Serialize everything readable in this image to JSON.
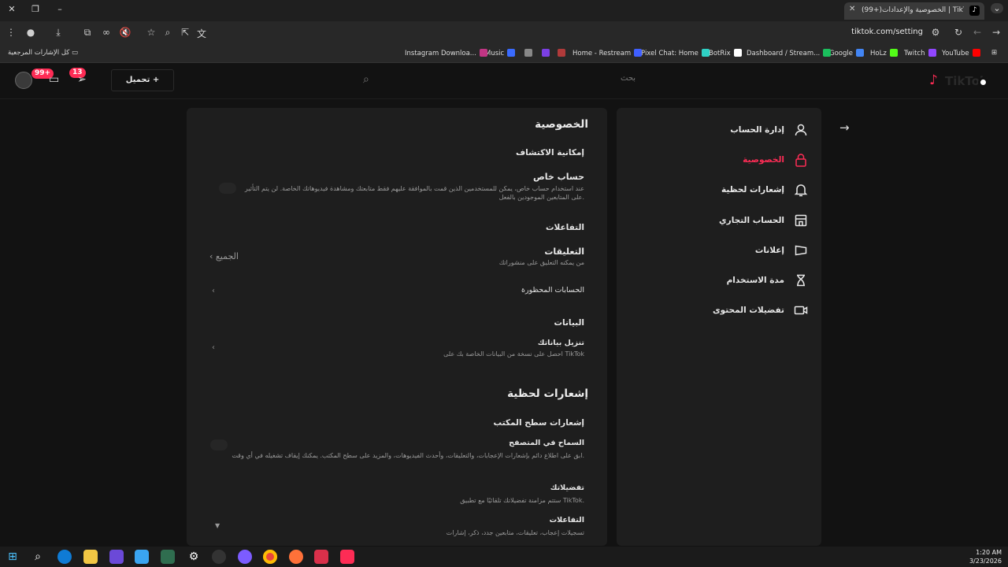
{
  "browser": {
    "tab_title": "(99+)الخصوصية والإعدادات | TikTok",
    "tab_icon": "tiktok-icon",
    "url": "tiktok.com/setting",
    "bookmarks_all_label": "كل الإشارات المرجعية",
    "bookmarks": [
      {
        "label": "YouTube",
        "color": "#ff0000"
      },
      {
        "label": "Twitch",
        "color": "#9146ff"
      },
      {
        "label": "HoLz",
        "color": "#53fc18"
      },
      {
        "label": "Google",
        "color": "#4285f4"
      },
      {
        "label": "Dashboard / Stream...",
        "color": "#1bbf5d"
      },
      {
        "label": "BotRix",
        "color": "#ffffff"
      },
      {
        "label": "Pixel Chat: Home",
        "color": "#2fd1c5"
      },
      {
        "label": "Home - Restream",
        "color": "#3f5fff"
      },
      {
        "label": "Music",
        "color": "#3a6bff"
      },
      {
        "label": "Instagram Downloa...",
        "color": "#c13584"
      }
    ]
  },
  "header": {
    "upload_label": "تحميل",
    "search_placeholder": "بحث",
    "inbox_badge": "99+",
    "notifications_badge": "13",
    "logo_text": "TikTok"
  },
  "nav": {
    "items": [
      {
        "label": "إدارة الحساب",
        "icon": "person-icon",
        "active": false
      },
      {
        "label": "الخصوصية",
        "icon": "lock-icon",
        "active": true
      },
      {
        "label": "إشعارات لحظية",
        "icon": "bell-icon",
        "active": false
      },
      {
        "label": "الحساب التجاري",
        "icon": "store-icon",
        "active": false
      },
      {
        "label": "إعلانات",
        "icon": "megaphone-icon",
        "active": false
      },
      {
        "label": "مدة الاستخدام",
        "icon": "hourglass-icon",
        "active": false
      },
      {
        "label": "تفضيلات المحتوى",
        "icon": "video-icon",
        "active": false
      }
    ],
    "back_icon": "arrow-right-icon"
  },
  "privacy": {
    "title": "الخصوصية",
    "discoverability": "إمكانية الاكتشاف",
    "private_account_title": "حساب خاص",
    "private_account_desc": "عند استخدام حساب خاص، يمكن للمستخدمين الذين قمت بالموافقة عليهم فقط متابعتك ومشاهدة فيديوهاتك الخاصة. لن يتم التأثير على المتابعين الموجودين بالفعل.",
    "interactions": "التفاعلات",
    "comments_title": "التعليقات",
    "comments_desc": "من يمكنه التعليق على منشوراتك",
    "comments_value": "الجميع",
    "blocked_accounts": "الحسابات المحظورة",
    "data": "البيانات",
    "download_data_title": "تنزيل بياناتك",
    "download_data_desc": "احصل على نسخة من البيانات الخاصة بك على TikTok"
  },
  "push": {
    "title": "إشعارات لحظية",
    "desktop": "إشعارات سطح المكتب",
    "allow_browser_title": "السماح في المتصفح",
    "allow_browser_desc": "ابق على اطلاع دائم بإشعارات الإعجابات، والتعليقات، وأحدث الفيديوهات، والمزيد على سطح المكتب. يمكنك إيقاف تشغيله في أي وقت.",
    "preferences_title": "تفضيلاتك",
    "preferences_desc": "ستتم مزامنة تفضيلاتك تلقائيًا مع تطبيق TikTok.",
    "interactions_title": "التفاعلات",
    "interactions_desc": "تسجيلات إعجاب، تعليقات، متابعين جدد، ذكر، إشارات"
  },
  "taskbar": {
    "time": "1:20 AM",
    "date": "3/23/2026"
  }
}
